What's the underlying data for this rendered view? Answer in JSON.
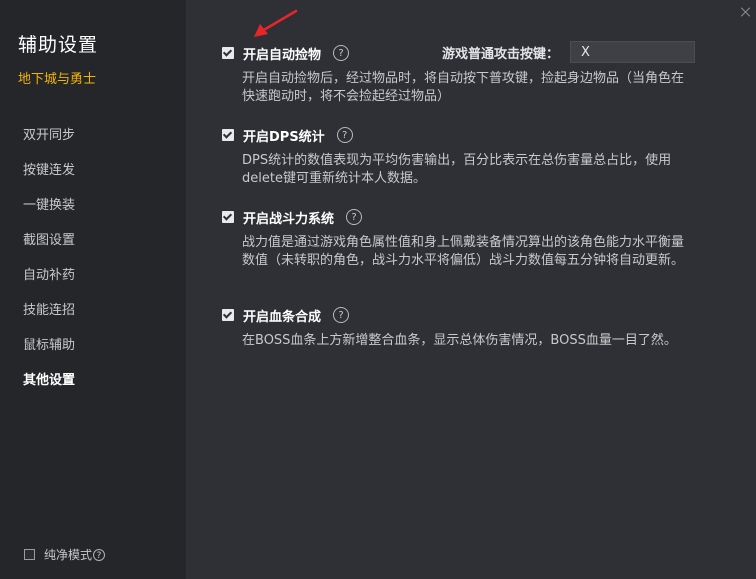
{
  "sidebar": {
    "title": "辅助设置",
    "subtitle": "地下城与勇士",
    "items": [
      {
        "label": "双开同步"
      },
      {
        "label": "按键连发"
      },
      {
        "label": "一键换装"
      },
      {
        "label": "截图设置"
      },
      {
        "label": "自动补药"
      },
      {
        "label": "技能连招"
      },
      {
        "label": "鼠标辅助"
      },
      {
        "label": "其他设置"
      }
    ],
    "active_item": "其他设置",
    "pure_mode_label": "纯净模式",
    "pure_mode_help": "?"
  },
  "main": {
    "help_glyph": "?",
    "options": [
      {
        "label": "开启自动捡物",
        "checked": true,
        "desc": "开启自动捡物后，经过物品时，将自动按下普攻键，捡起身边物品（当角色在快速跑动时，将不会捡起经过物品）"
      },
      {
        "label": "开启DPS统计",
        "checked": true,
        "desc": "DPS统计的数值表现为平均伤害输出，百分比表示在总伤害量总占比，使用delete键可重新统计本人数据。"
      },
      {
        "label": "开启战斗力系统",
        "checked": true,
        "desc": "战力值是通过游戏角色属性值和身上佩戴装备情况算出的该角色能力水平衡量数值（未转职的角色，战斗力水平将偏低）战斗力数值每五分钟将自动更新。"
      },
      {
        "label": "开启血条合成",
        "checked": true,
        "desc": "在BOSS血条上方新增整合血条，显示总体伤害情况，BOSS血量一目了然。"
      }
    ],
    "hotkey": {
      "label": "游戏普通攻击按键：",
      "value": "X"
    }
  },
  "colors": {
    "sidebar_bg": "#25262a",
    "main_bg": "#2f3035",
    "accent": "#f5b400",
    "arrow": "#e8262a"
  }
}
